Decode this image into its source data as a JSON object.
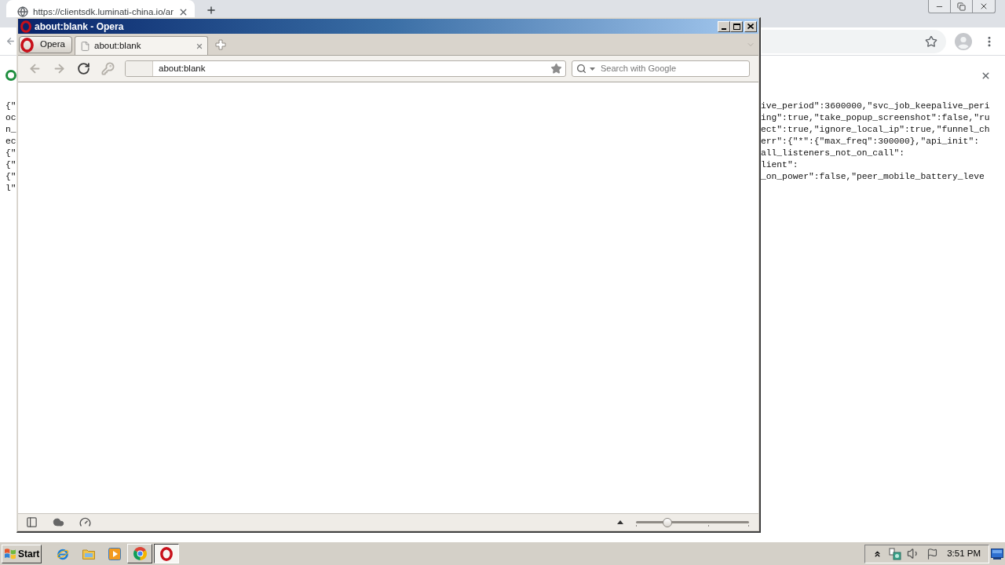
{
  "chrome": {
    "tabs": [
      {
        "title": "https://clientsdk.luminati-china.io/ar",
        "selected": true
      }
    ],
    "page_lines": [
      {
        "left": "{\"",
        "right": "ive_period\":3600000,\"svc_job_keepalive_peri"
      },
      {
        "left": "oc",
        "right": "ing\":true,\"take_popup_screenshot\":false,\"ru"
      },
      {
        "left": "n_",
        "right": "ect\":true,\"ignore_local_ip\":true,\"funnel_ch"
      },
      {
        "left": "ec",
        "right": "err\":{\"*\":{\"max_freq\":300000},\"api_init\":"
      },
      {
        "left": "{\"",
        "right": "all_listeners_not_on_call\":"
      },
      {
        "left": "{\"",
        "right": "lient\":"
      },
      {
        "left": "{\"",
        "right": "_on_power\":false,\"peer_mobile_battery_leve"
      },
      {
        "left": "l\""
      }
    ]
  },
  "opera": {
    "title": "about:blank - Opera",
    "menu_button": "Opera",
    "tabs": [
      {
        "label": "about:blank",
        "selected": true
      }
    ],
    "nav_buttons": [
      {
        "kind": "back",
        "disabled": true
      },
      {
        "kind": "forward",
        "disabled": true
      },
      {
        "kind": "reload",
        "disabled": false
      },
      {
        "kind": "wand",
        "disabled": true
      }
    ],
    "address": {
      "value": "about:blank"
    },
    "search": {
      "placeholder": "Search with Google"
    },
    "zoom_slider": {
      "level": 0.28
    }
  },
  "taskbar": {
    "start": "Start",
    "tasks": [
      {
        "selected": false
      },
      {
        "selected": true
      }
    ],
    "clock": "3:51 PM"
  }
}
